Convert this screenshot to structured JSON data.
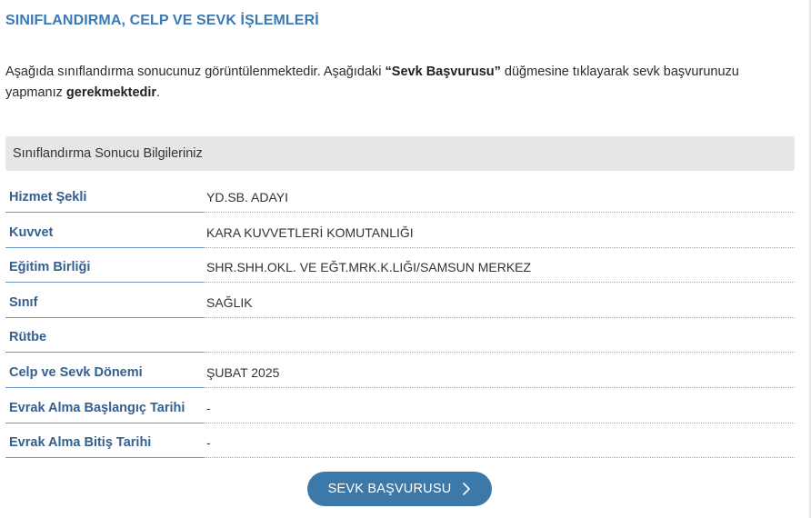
{
  "page": {
    "title": "SINIFLANDIRMA, CELP VE SEVK İŞLEMLERİ"
  },
  "intro": {
    "part1": "Aşağıda sınıflandırma sonucunuz görüntülenmektedir. Aşağıdaki ",
    "highlight1": "“Sevk Başvurusu”",
    "part2": " düğmesine tıklayarak sevk başvurunuzu yapmanız ",
    "highlight2": "gerekmektedir",
    "part3": "."
  },
  "section": {
    "header": "Sınıflandırma Sonucu Bilgileriniz"
  },
  "rows": [
    {
      "label": "Hizmet Şekli",
      "value": "YD.SB. ADAYI"
    },
    {
      "label": "Kuvvet",
      "value": "KARA KUVVETLERİ KOMUTANLIĞI"
    },
    {
      "label": "Eğitim Birliği",
      "value": "SHR.SHH.OKL. VE EĞT.MRK.K.LIĞI/SAMSUN MERKEZ"
    },
    {
      "label": "Sınıf",
      "value": "SAĞLIK"
    },
    {
      "label": "Rütbe",
      "value": ""
    },
    {
      "label": "Celp ve Sevk Dönemi",
      "value": "ŞUBAT 2025"
    },
    {
      "label": "Evrak Alma Başlangıç Tarihi",
      "value": "-"
    },
    {
      "label": "Evrak Alma Bitiş Tarihi",
      "value": "-"
    }
  ],
  "actions": {
    "apply_label": "SEVK BAŞVURUSU",
    "apply_icon": "chevron-right-icon"
  },
  "colors": {
    "title": "#3a7ab4",
    "label": "#34608f",
    "button": "#3d79a8",
    "section_bg": "#e4e6e8"
  }
}
